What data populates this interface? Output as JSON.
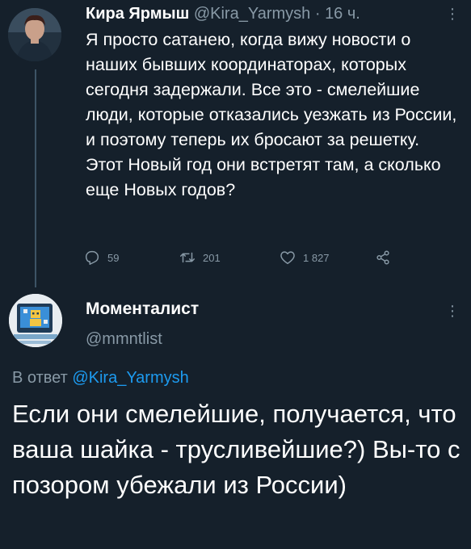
{
  "tweet": {
    "author_name": "Кира Ярмыш",
    "handle": "@Kira_Yarmysh",
    "separator": "·",
    "time": "16 ч.",
    "text": "Я просто сатанею, когда вижу новости о наших бывших координаторах, которых сегодня задержали. Все это - смелейшие люди, которые отказались уезжать из России, и поэтому теперь их бросают за решетку. Этот Новый год они встретят там, а сколько еще Новых годов?",
    "replies": "59",
    "retweets": "201",
    "likes": "1 827"
  },
  "reply": {
    "author_name": "Моменталист",
    "handle": "@mmntlist",
    "reply_prefix": "В ответ",
    "reply_to": "@Kira_Yarmysh",
    "text": "Если они смелейшие, получается, что ваша шайка - трусливейшие?) Вы-то с позором убежали из России)"
  },
  "icons": {
    "more": "more-vertical-icon",
    "reply": "reply-icon",
    "retweet": "retweet-icon",
    "like": "heart-icon",
    "share": "share-icon"
  },
  "colors": {
    "background": "#15202b",
    "muted": "#8899a6",
    "link": "#1d9bf0"
  }
}
